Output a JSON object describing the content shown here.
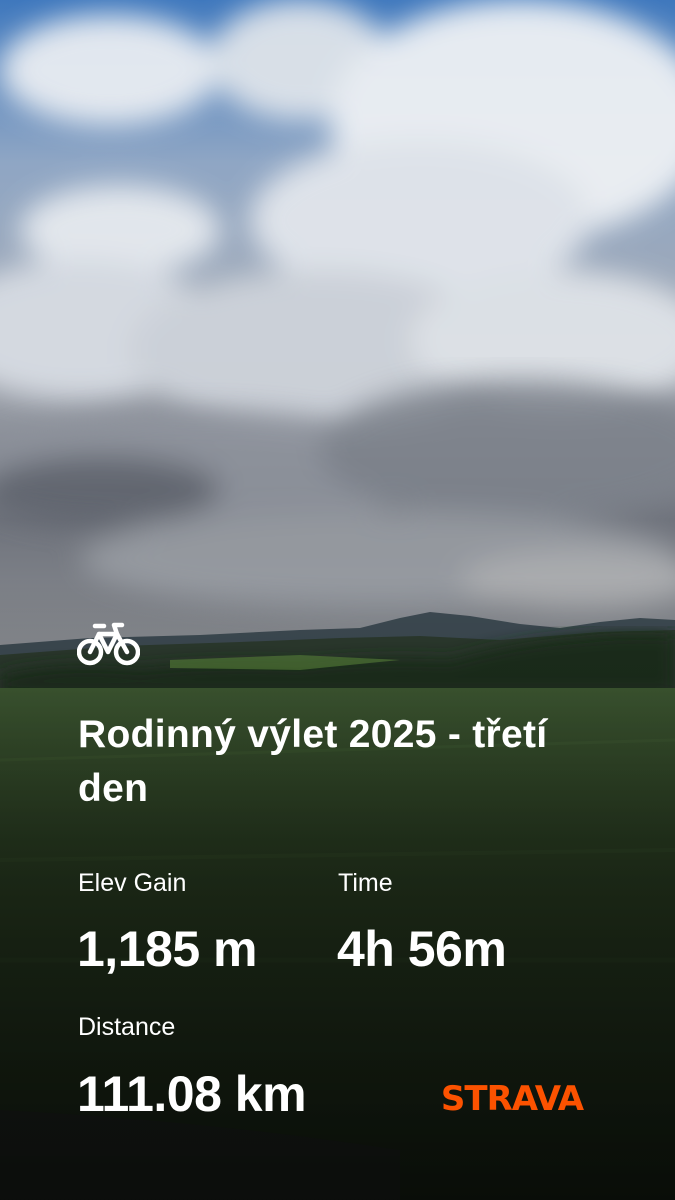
{
  "activity": {
    "icon": "bicycle-icon",
    "title": "Rodinný výlet 2025 - třetí den"
  },
  "stats": {
    "elev_gain": {
      "label": "Elev Gain",
      "value": "1,185 m"
    },
    "time": {
      "label": "Time",
      "value": "4h 56m"
    },
    "distance": {
      "label": "Distance",
      "value": "111.08 km"
    }
  },
  "brand": {
    "name": "STRAVA",
    "color": "#FC5200"
  }
}
